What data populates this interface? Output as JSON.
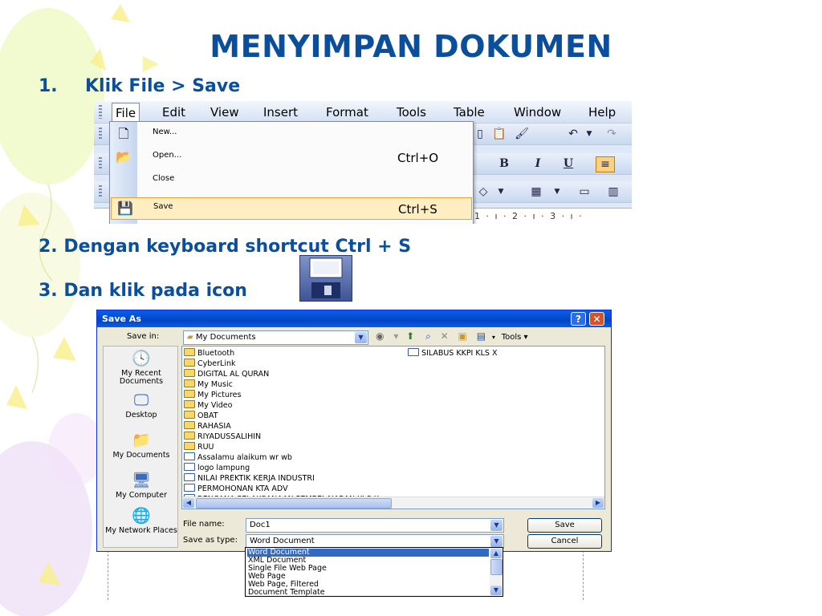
{
  "slide": {
    "title": "MENYIMPAN DOKUMEN",
    "step1_num": "1.",
    "step1_text": "Klik File > Save",
    "step2": "2. Dengan keyboard shortcut Ctrl + S",
    "step3": "3. Dan klik pada  icon",
    "text_color": "#0b4f9c"
  },
  "word": {
    "menubar": [
      "File",
      "Edit",
      "View",
      "Insert",
      "Format",
      "Tools",
      "Table",
      "Window",
      "Help"
    ],
    "file_menu": [
      {
        "label": "New...",
        "shortcut": "",
        "icon": "new-document-icon"
      },
      {
        "label": "Open...",
        "shortcut": "Ctrl+O",
        "icon": "open-folder-icon"
      },
      {
        "label": "Close",
        "shortcut": "",
        "icon": ""
      },
      {
        "label": "Save",
        "shortcut": "Ctrl+S",
        "icon": "floppy-disk-icon"
      }
    ],
    "toolbar_format": {
      "bold": "B",
      "italic": "I",
      "underline": "U"
    },
    "ruler": "1 · ı · 2 · ı · 3 · ı ·",
    "highlight_color": "#ffeec2"
  },
  "save_as": {
    "title": "Save As",
    "help_btn": "?",
    "close_btn": "✕",
    "save_in_label": "Save in:",
    "save_in_value": "My Documents",
    "tools_label": "Tools",
    "places": [
      "My Recent Documents",
      "Desktop",
      "My Documents",
      "My Computer",
      "My Network Places"
    ],
    "files_col1": [
      {
        "name": "Bluetooth",
        "kind": "folder"
      },
      {
        "name": "CyberLink",
        "kind": "folder"
      },
      {
        "name": "DIGITAL AL QURAN",
        "kind": "folder"
      },
      {
        "name": "My Music",
        "kind": "folder"
      },
      {
        "name": "My Pictures",
        "kind": "folder"
      },
      {
        "name": "My Video",
        "kind": "folder"
      },
      {
        "name": "OBAT",
        "kind": "folder"
      },
      {
        "name": "RAHASIA",
        "kind": "folder"
      },
      {
        "name": "RIYADUSSALIHIN",
        "kind": "folder"
      },
      {
        "name": "RUU",
        "kind": "folder"
      },
      {
        "name": "Assalamu alaikum wr wb",
        "kind": "doc"
      },
      {
        "name": "logo lampung",
        "kind": "doc"
      },
      {
        "name": "NILAI PREKTIK KERJA INDUSTRI",
        "kind": "doc"
      },
      {
        "name": "PERMOHONAN KTA ADV",
        "kind": "doc"
      },
      {
        "name": "RENCANA PELAKSANAAN PEMBELAJARAN KLS X",
        "kind": "doc"
      }
    ],
    "files_col2": [
      {
        "name": "SILABUS KKPI KLS X",
        "kind": "doc"
      }
    ],
    "file_name_label": "File name:",
    "file_name_value": "Doc1",
    "save_type_label": "Save as type:",
    "save_type_value": "Word Document",
    "save_button": "Save",
    "cancel_button": "Cancel",
    "type_options": [
      "Word Document",
      "XML Document",
      "Single File Web Page",
      "Web Page",
      "Web Page, Filtered",
      "Document Template"
    ],
    "selected_type_index": 0
  }
}
